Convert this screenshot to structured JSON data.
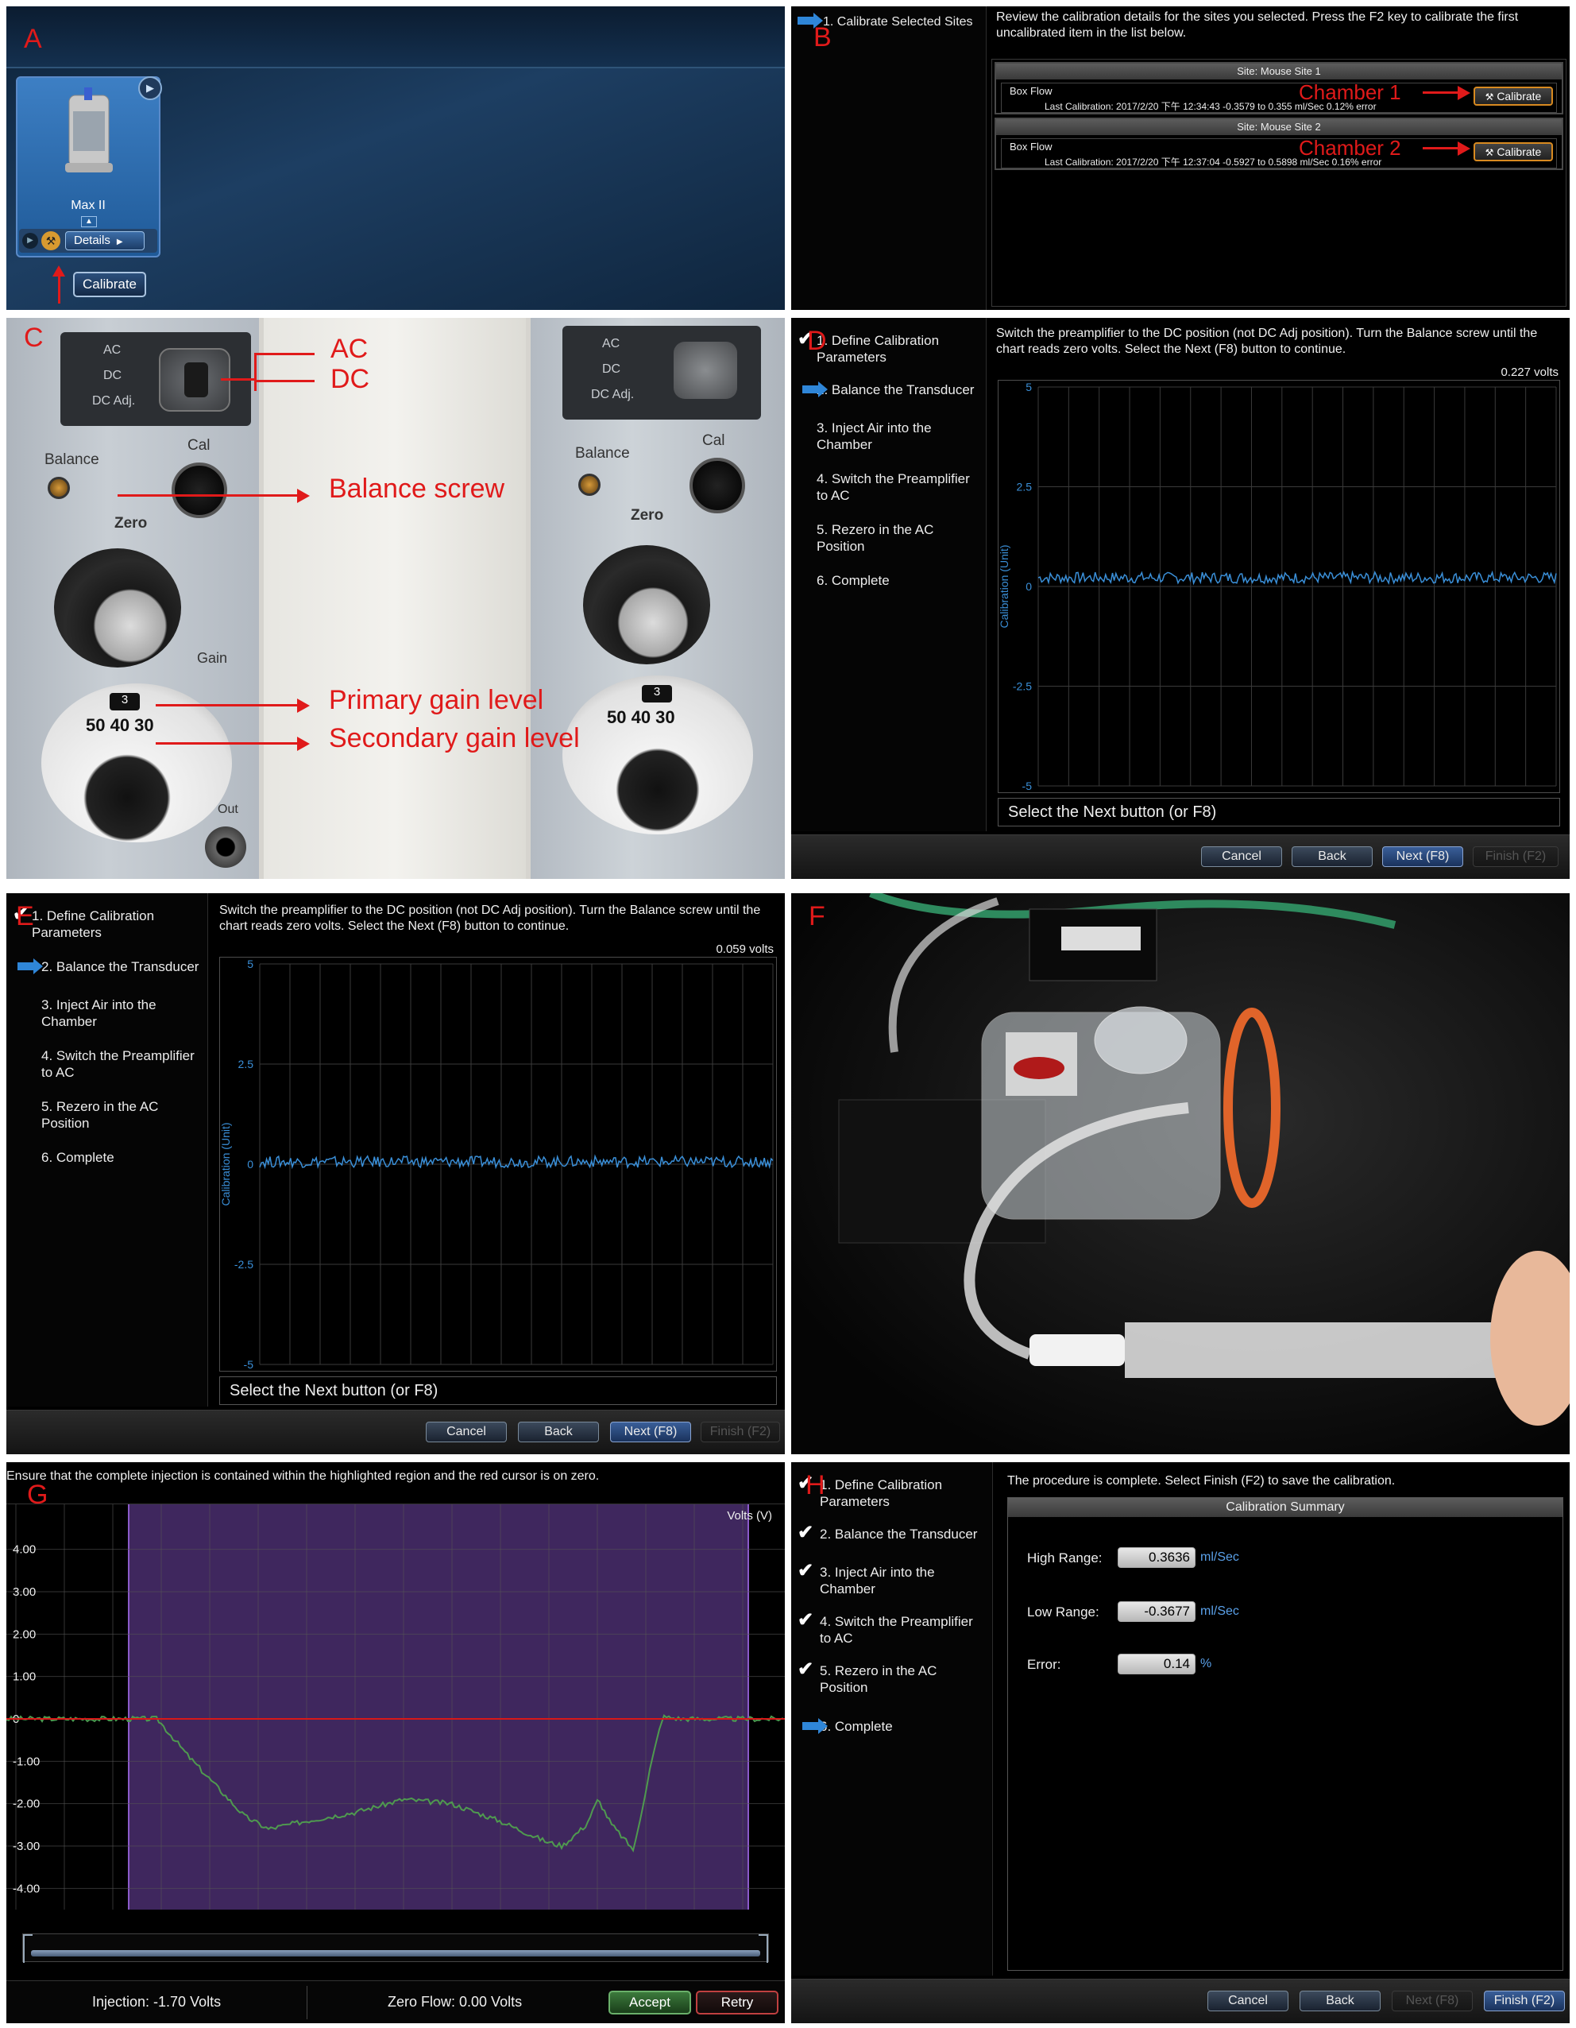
{
  "panel_labels": {
    "a": "A",
    "b": "B",
    "c": "C",
    "d": "D",
    "e": "E",
    "f": "F",
    "g": "G",
    "h": "H"
  },
  "panel_a": {
    "device_name": "Max II",
    "details_label": "Details",
    "calibrate_label": "Calibrate"
  },
  "panel_b": {
    "step": "1. Calibrate Selected Sites",
    "instruction": "Review the calibration details for the sites you selected. Press the F2 key to calibrate the first uncalibrated item in the list below.",
    "sites": [
      {
        "header": "Site: Mouse Site 1",
        "item": "Box Flow",
        "last_cal": "Last Calibration: 2017/2/20 下午 12:34:43    -0.3579 to 0.355 ml/Sec 0.12% error",
        "annotation": "Chamber 1",
        "button": "Calibrate"
      },
      {
        "header": "Site: Mouse Site 2",
        "item": "Box Flow",
        "last_cal": "Last Calibration: 2017/2/20 下午 12:37:04    -0.5927 to 0.5898 ml/Sec 0.16% error",
        "annotation": "Chamber 2",
        "button": "Calibrate"
      }
    ]
  },
  "panel_c": {
    "switch_labels": [
      "AC",
      "DC",
      "DC Adj."
    ],
    "balance": "Balance",
    "cal": "Cal",
    "zero": "Zero",
    "gain": "Gain",
    "out": "Out",
    "dial_nums": "50 40 30",
    "annotations": {
      "ac": "AC",
      "dc": "DC",
      "balance_screw": "Balance screw",
      "primary_gain": "Primary gain level",
      "secondary_gain": "Secondary  gain level"
    }
  },
  "steps": [
    "1. Define Calibration Parameters",
    "2. Balance the Transducer",
    "3. Inject Air into the Chamber",
    "4. Switch the Preamplifier to AC",
    "5. Rezero in the AC Position",
    "6. Complete"
  ],
  "balance_instruction": "Switch the preamplifier to the DC position (not DC Adj position).  Turn the Balance screw until the chart reads zero volts.  Select the Next (F8) button to continue.",
  "panel_d": {
    "reading": "0.227 volts",
    "select_next": "Select the Next button (or F8)"
  },
  "panel_e": {
    "reading": "0.059 volts",
    "select_next": "Select the Next button (or F8)"
  },
  "balance_chart": {
    "ylabel": "Calibration (Unit)",
    "yticks": [
      "5",
      "2.5",
      "0",
      "-2.5",
      "-5"
    ],
    "ylim": [
      -5,
      5
    ]
  },
  "buttons": {
    "cancel": "Cancel",
    "back": "Back",
    "next": "Next (F8)",
    "finish": "Finish (F2)",
    "accept": "Accept",
    "retry": "Retry"
  },
  "panel_g": {
    "instruction": "Ensure that the complete injection is contained within the highlighted region and the red cursor is on zero.",
    "unit": "Volts (V)",
    "yticks": [
      "4.00",
      "3.00",
      "2.00",
      "1.00",
      "0",
      "-1.00",
      "-2.00",
      "-3.00",
      "-4.00"
    ],
    "injection": "Injection: -1.70 Volts",
    "zero_flow": "Zero Flow: 0.00 Volts"
  },
  "panel_h": {
    "instruction": "The procedure is complete. Select Finish (F2) to save the calibration.",
    "summary_title": "Calibration Summary",
    "rows": [
      {
        "label": "High Range:",
        "value": "0.3636",
        "unit": "ml/Sec"
      },
      {
        "label": "Low Range:",
        "value": "-0.3677",
        "unit": "ml/Sec"
      },
      {
        "label": "Error:",
        "value": "0.14",
        "unit": "%"
      }
    ]
  },
  "colors": {
    "annotation_red": "#e01a1a",
    "trace_blue": "#3a8fd8",
    "trace_green": "#4f9a4f",
    "cursor_red": "#d81818",
    "region_purple": "#4a2e6e",
    "step_arrow_blue": "#2f86d8"
  }
}
